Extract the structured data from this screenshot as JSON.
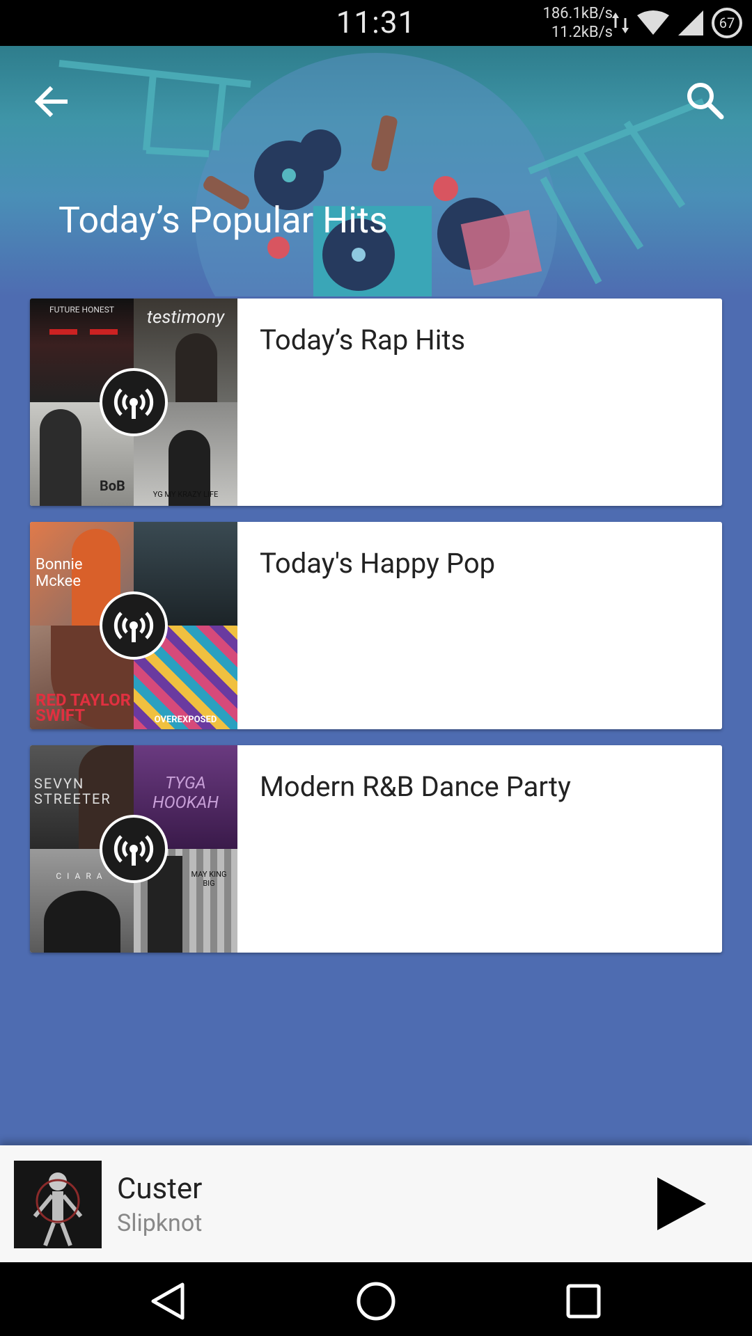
{
  "status_bar": {
    "time": "11:31",
    "download_speed": "186.1kB/s",
    "upload_speed": "11.2kB/s",
    "battery_level": "67",
    "icons": [
      "data-transfer-icon",
      "wifi-icon",
      "cell-signal-icon",
      "battery-icon"
    ]
  },
  "header": {
    "title": "Today’s Popular Hits",
    "back_icon": "arrow-back-icon",
    "search_icon": "search-icon"
  },
  "playlists": [
    {
      "title": "Today’s Rap Hits",
      "art_labels": [
        "FUTURE HONEST",
        "testimony",
        "",
        "YG MY KRAZY LIFE"
      ],
      "tile_colors": [
        "#2a2a2a",
        "#3b3732",
        "#9a9a96",
        "#7a7a78"
      ]
    },
    {
      "title": "Today's Happy Pop",
      "art_labels": [
        "Bonnie Mckee",
        "",
        "RED TAYLOR SWIFT",
        "OVEREXPOSED"
      ],
      "tile_colors": [
        "#b36a44",
        "#2e3a40",
        "#8b2730",
        "#d64a7a"
      ]
    },
    {
      "title": "Modern R&B Dance Party",
      "art_labels": [
        "SEVYN STREETER",
        "TYGA HOOKAH",
        "CIARA",
        "MAY KING BIG"
      ],
      "tile_colors": [
        "#4a4a4a",
        "#5a2c6e",
        "#7a7a7a",
        "#9a9a9a"
      ]
    }
  ],
  "now_playing": {
    "track": "Custer",
    "artist": "Slipknot",
    "play_icon": "play-icon"
  },
  "nav_bar": {
    "back_icon": "nav-back-icon",
    "home_icon": "nav-home-icon",
    "recents_icon": "nav-recents-icon"
  },
  "colors": {
    "background": "#4e6cb1",
    "header_teal": "#2e7d8c",
    "card": "#ffffff"
  }
}
